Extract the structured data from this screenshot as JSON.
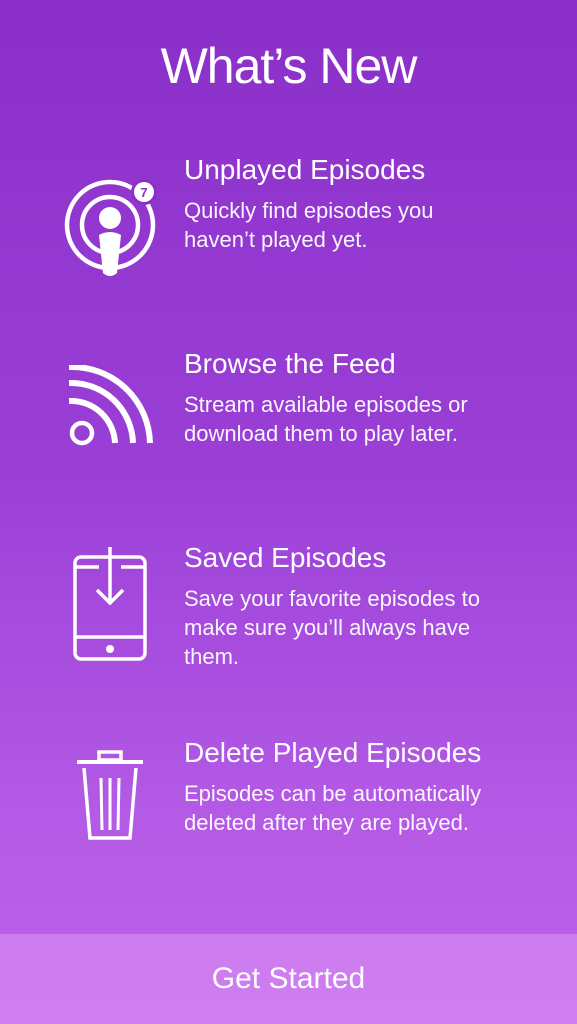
{
  "header": {
    "title": "What’s New"
  },
  "features": [
    {
      "icon": "podcast-icon",
      "badge": "7",
      "title": "Unplayed Episodes",
      "description_line1": "Quickly find episodes you",
      "description_line2": "haven’t played yet."
    },
    {
      "icon": "rss-feed-icon",
      "title": "Browse the Feed",
      "description_line1": "Stream available episodes or",
      "description_line2": "download them to play later."
    },
    {
      "icon": "phone-download-icon",
      "title": "Saved Episodes",
      "description_line1": "Save your favorite episodes to",
      "description_line2": "make sure you’ll always have",
      "description_line3": "them."
    },
    {
      "icon": "trash-icon",
      "title": "Delete Played Episodes",
      "description_line1": "Episodes can be automatically",
      "description_line2": "deleted after they are played."
    }
  ],
  "footer": {
    "button_label": "Get Started"
  },
  "colors": {
    "background_top": "#8a2fc8",
    "background_bottom": "#bf62ea",
    "button_background": "#d7a0f0",
    "badge_text": "#8a2fc8"
  }
}
